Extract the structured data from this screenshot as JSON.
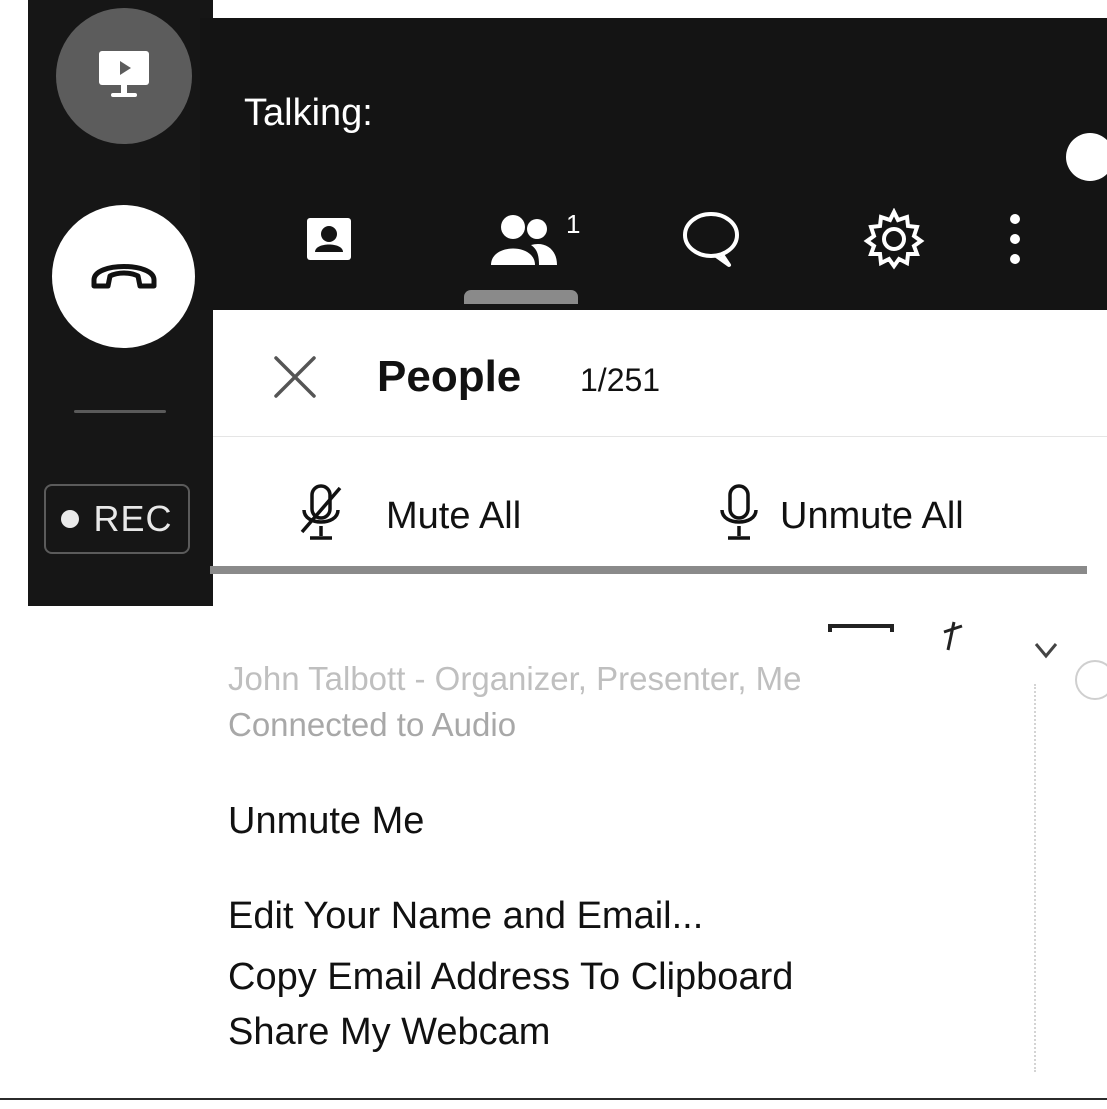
{
  "rail": {
    "rec_label": "REC"
  },
  "topbar": {
    "talking_label": "Talking:",
    "tabs": [
      {
        "id": "video",
        "icon": "person-card-icon"
      },
      {
        "id": "people",
        "icon": "people-icon",
        "badge": "1",
        "active": true
      },
      {
        "id": "chat",
        "icon": "chat-bubble-icon"
      },
      {
        "id": "settings",
        "icon": "gear-icon"
      },
      {
        "id": "more",
        "icon": "more-vertical-icon"
      }
    ]
  },
  "people_panel": {
    "title": "People",
    "count": "1/251",
    "mute_all_label": "Mute All",
    "unmute_all_label": "Unmute All"
  },
  "participant": {
    "name": "John Talbott - Organizer, Presenter, Me",
    "status": "Connected to Audio"
  },
  "context_menu": {
    "items": [
      "Unmute Me",
      "Edit Your Name and Email...",
      "Copy Email Address To Clipboard",
      "Share My Webcam"
    ]
  },
  "colors": {
    "dark_bg": "#161616",
    "share_button": "#5c5c5c",
    "text_muted": "#a8a8a8"
  }
}
